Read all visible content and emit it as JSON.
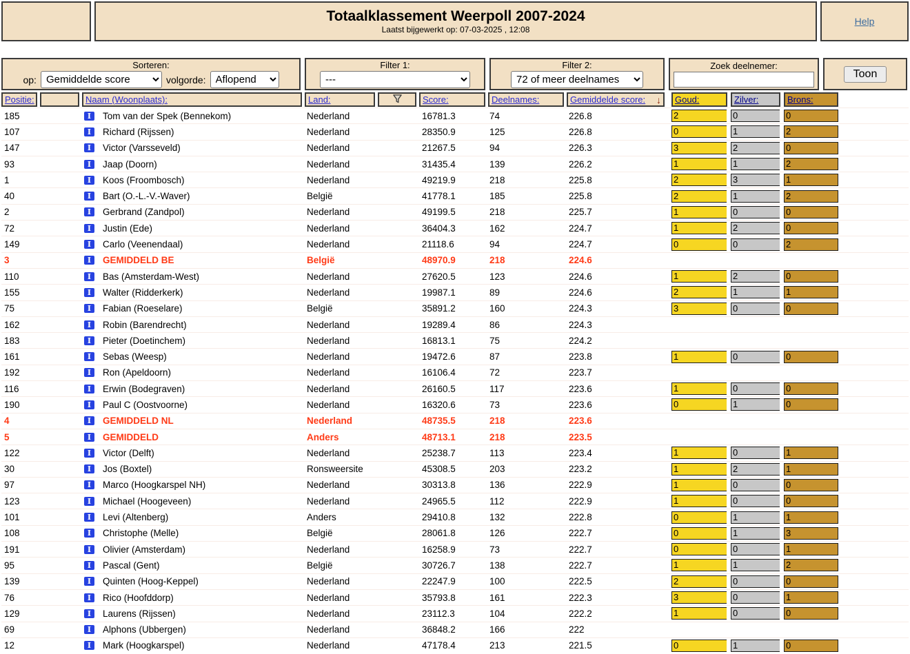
{
  "header": {
    "title": "Totaalklassement Weerpoll 2007-2024",
    "subtitle": "Laatst bijgewerkt op: 07-03-2025 , 12:08",
    "help_label": "Help"
  },
  "controls": {
    "sort_title": "Sorteren:",
    "op_label": "op:",
    "sort_value": "Gemiddelde score",
    "volgorde_label": "volgorde:",
    "order_value": "Aflopend",
    "filter1_title": "Filter 1:",
    "filter1_value": "---",
    "filter2_title": "Filter 2:",
    "filter2_value": "72 of meer deelnames",
    "search_title": "Zoek deelnemer:",
    "search_value": "",
    "show_button": "Toon"
  },
  "table": {
    "columns": {
      "positie": "Positie:",
      "naam": "Naam (Woonplaats):",
      "land": "Land:",
      "score": "Score:",
      "deelnames": "Deelnames:",
      "gemiddelde": "Gemiddelde score:",
      "goud": "Goud:",
      "zilver": "Zilver:",
      "brons": "Brons:",
      "sort_arrow": "↓",
      "funnel_icon": "filter-funnel-icon",
      "info_icon_glyph": "I"
    },
    "rows": [
      {
        "pos": "185",
        "name": "Tom van der Spek (Bennekom)",
        "land": "Nederland",
        "score": "16781.3",
        "deel": "74",
        "gem": "226.8",
        "goud": "2",
        "zilver": "0",
        "brons": "0",
        "red": false
      },
      {
        "pos": "107",
        "name": "Richard (Rijssen)",
        "land": "Nederland",
        "score": "28350.9",
        "deel": "125",
        "gem": "226.8",
        "goud": "0",
        "zilver": "1",
        "brons": "2",
        "red": false
      },
      {
        "pos": "147",
        "name": "Victor (Varsseveld)",
        "land": "Nederland",
        "score": "21267.5",
        "deel": "94",
        "gem": "226.3",
        "goud": "3",
        "zilver": "2",
        "brons": "0",
        "red": false
      },
      {
        "pos": "93",
        "name": "Jaap (Doorn)",
        "land": "Nederland",
        "score": "31435.4",
        "deel": "139",
        "gem": "226.2",
        "goud": "1",
        "zilver": "1",
        "brons": "2",
        "red": false
      },
      {
        "pos": "1",
        "name": "Koos (Froombosch)",
        "land": "Nederland",
        "score": "49219.9",
        "deel": "218",
        "gem": "225.8",
        "goud": "2",
        "zilver": "3",
        "brons": "1",
        "red": false
      },
      {
        "pos": "40",
        "name": "Bart (O.-L.-V.-Waver)",
        "land": "België",
        "score": "41778.1",
        "deel": "185",
        "gem": "225.8",
        "goud": "2",
        "zilver": "1",
        "brons": "2",
        "red": false
      },
      {
        "pos": "2",
        "name": "Gerbrand (Zandpol)",
        "land": "Nederland",
        "score": "49199.5",
        "deel": "218",
        "gem": "225.7",
        "goud": "1",
        "zilver": "0",
        "brons": "0",
        "red": false
      },
      {
        "pos": "72",
        "name": "Justin (Ede)",
        "land": "Nederland",
        "score": "36404.3",
        "deel": "162",
        "gem": "224.7",
        "goud": "1",
        "zilver": "2",
        "brons": "0",
        "red": false
      },
      {
        "pos": "149",
        "name": "Carlo (Veenendaal)",
        "land": "Nederland",
        "score": "21118.6",
        "deel": "94",
        "gem": "224.7",
        "goud": "0",
        "zilver": "0",
        "brons": "2",
        "red": false
      },
      {
        "pos": "3",
        "name": "GEMIDDELD BE",
        "land": "België",
        "score": "48970.9",
        "deel": "218",
        "gem": "224.6",
        "goud": null,
        "zilver": null,
        "brons": null,
        "red": true
      },
      {
        "pos": "110",
        "name": "Bas (Amsterdam-West)",
        "land": "Nederland",
        "score": "27620.5",
        "deel": "123",
        "gem": "224.6",
        "goud": "1",
        "zilver": "2",
        "brons": "0",
        "red": false
      },
      {
        "pos": "155",
        "name": "Walter (Ridderkerk)",
        "land": "Nederland",
        "score": "19987.1",
        "deel": "89",
        "gem": "224.6",
        "goud": "2",
        "zilver": "1",
        "brons": "1",
        "red": false
      },
      {
        "pos": "75",
        "name": "Fabian (Roeselare)",
        "land": "België",
        "score": "35891.2",
        "deel": "160",
        "gem": "224.3",
        "goud": "3",
        "zilver": "0",
        "brons": "0",
        "red": false
      },
      {
        "pos": "162",
        "name": "Robin (Barendrecht)",
        "land": "Nederland",
        "score": "19289.4",
        "deel": "86",
        "gem": "224.3",
        "goud": null,
        "zilver": null,
        "brons": null,
        "red": false
      },
      {
        "pos": "183",
        "name": "Pieter (Doetinchem)",
        "land": "Nederland",
        "score": "16813.1",
        "deel": "75",
        "gem": "224.2",
        "goud": null,
        "zilver": null,
        "brons": null,
        "red": false
      },
      {
        "pos": "161",
        "name": "Sebas (Weesp)",
        "land": "Nederland",
        "score": "19472.6",
        "deel": "87",
        "gem": "223.8",
        "goud": "1",
        "zilver": "0",
        "brons": "0",
        "red": false
      },
      {
        "pos": "192",
        "name": "Ron (Apeldoorn)",
        "land": "Nederland",
        "score": "16106.4",
        "deel": "72",
        "gem": "223.7",
        "goud": null,
        "zilver": null,
        "brons": null,
        "red": false
      },
      {
        "pos": "116",
        "name": "Erwin (Bodegraven)",
        "land": "Nederland",
        "score": "26160.5",
        "deel": "117",
        "gem": "223.6",
        "goud": "1",
        "zilver": "0",
        "brons": "0",
        "red": false
      },
      {
        "pos": "190",
        "name": "Paul C (Oostvoorne)",
        "land": "Nederland",
        "score": "16320.6",
        "deel": "73",
        "gem": "223.6",
        "goud": "0",
        "zilver": "1",
        "brons": "0",
        "red": false
      },
      {
        "pos": "4",
        "name": "GEMIDDELD NL",
        "land": "Nederland",
        "score": "48735.5",
        "deel": "218",
        "gem": "223.6",
        "goud": null,
        "zilver": null,
        "brons": null,
        "red": true
      },
      {
        "pos": "5",
        "name": "GEMIDDELD",
        "land": "Anders",
        "score": "48713.1",
        "deel": "218",
        "gem": "223.5",
        "goud": null,
        "zilver": null,
        "brons": null,
        "red": true
      },
      {
        "pos": "122",
        "name": "Victor (Delft)",
        "land": "Nederland",
        "score": "25238.7",
        "deel": "113",
        "gem": "223.4",
        "goud": "1",
        "zilver": "0",
        "brons": "1",
        "red": false
      },
      {
        "pos": "30",
        "name": "Jos (Boxtel)",
        "land": "Ronsweersite",
        "score": "45308.5",
        "deel": "203",
        "gem": "223.2",
        "goud": "1",
        "zilver": "2",
        "brons": "1",
        "red": false
      },
      {
        "pos": "97",
        "name": "Marco (Hoogkarspel NH)",
        "land": "Nederland",
        "score": "30313.8",
        "deel": "136",
        "gem": "222.9",
        "goud": "1",
        "zilver": "0",
        "brons": "0",
        "red": false
      },
      {
        "pos": "123",
        "name": "Michael (Hoogeveen)",
        "land": "Nederland",
        "score": "24965.5",
        "deel": "112",
        "gem": "222.9",
        "goud": "1",
        "zilver": "0",
        "brons": "0",
        "red": false
      },
      {
        "pos": "101",
        "name": "Levi (Altenberg)",
        "land": "Anders",
        "score": "29410.8",
        "deel": "132",
        "gem": "222.8",
        "goud": "0",
        "zilver": "1",
        "brons": "1",
        "red": false
      },
      {
        "pos": "108",
        "name": "Christophe (Melle)",
        "land": "België",
        "score": "28061.8",
        "deel": "126",
        "gem": "222.7",
        "goud": "0",
        "zilver": "1",
        "brons": "3",
        "red": false
      },
      {
        "pos": "191",
        "name": "Olivier (Amsterdam)",
        "land": "Nederland",
        "score": "16258.9",
        "deel": "73",
        "gem": "222.7",
        "goud": "0",
        "zilver": "0",
        "brons": "1",
        "red": false
      },
      {
        "pos": "95",
        "name": "Pascal (Gent)",
        "land": "België",
        "score": "30726.7",
        "deel": "138",
        "gem": "222.7",
        "goud": "1",
        "zilver": "1",
        "brons": "2",
        "red": false
      },
      {
        "pos": "139",
        "name": "Quinten (Hoog-Keppel)",
        "land": "Nederland",
        "score": "22247.9",
        "deel": "100",
        "gem": "222.5",
        "goud": "2",
        "zilver": "0",
        "brons": "0",
        "red": false
      },
      {
        "pos": "76",
        "name": "Rico (Hoofddorp)",
        "land": "Nederland",
        "score": "35793.8",
        "deel": "161",
        "gem": "222.3",
        "goud": "3",
        "zilver": "0",
        "brons": "1",
        "red": false
      },
      {
        "pos": "129",
        "name": "Laurens (Rijssen)",
        "land": "Nederland",
        "score": "23112.3",
        "deel": "104",
        "gem": "222.2",
        "goud": "1",
        "zilver": "0",
        "brons": "0",
        "red": false
      },
      {
        "pos": "69",
        "name": "Alphons (Ubbergen)",
        "land": "Nederland",
        "score": "36848.2",
        "deel": "166",
        "gem": "222",
        "goud": null,
        "zilver": null,
        "brons": null,
        "red": false
      },
      {
        "pos": "12",
        "name": "Mark (Hoogkarspel)",
        "land": "Nederland",
        "score": "47178.4",
        "deel": "213",
        "gem": "221.5",
        "goud": "0",
        "zilver": "1",
        "brons": "0",
        "red": false
      }
    ]
  },
  "colors": {
    "panel_tan": "#f2e0c4",
    "gold": "#f6d622",
    "silver": "#c7c7c7",
    "bronze": "#c6932f",
    "highlight_red": "#ff3a16",
    "header_link_blue": "#2b2bd0",
    "help_link_blue": "#3d6c9e"
  }
}
